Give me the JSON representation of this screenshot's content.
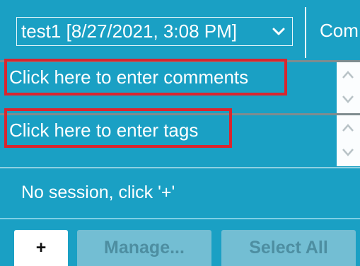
{
  "header": {
    "session_selected": "test1 [8/27/2021, 3:08 PM]",
    "tab_label": "Com"
  },
  "comments_field": {
    "placeholder": "Click here to enter comments"
  },
  "tags_field": {
    "placeholder": "Click here to enter tags"
  },
  "status": {
    "text": "No session, click '+'"
  },
  "buttons": {
    "add_label": "+",
    "manage_label": "Manage...",
    "select_all_label": "Select All"
  },
  "colors": {
    "panel_bg": "#1aa0c4",
    "highlight": "#d8262f",
    "disabled_button": "#73bed3"
  },
  "icons": {
    "dropdown": "chevron-down-icon",
    "scroll_up": "chevron-up-icon",
    "scroll_down": "chevron-down-icon"
  }
}
